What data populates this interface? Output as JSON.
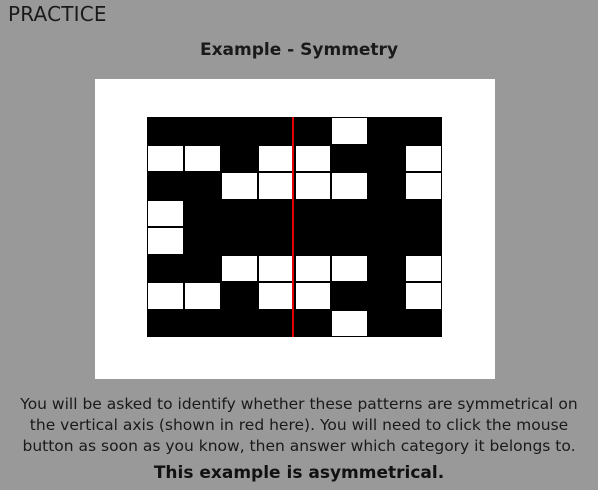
{
  "header": {
    "mode_label": "PRACTICE",
    "title": "Example - Symmetry"
  },
  "pattern": {
    "rows": 8,
    "cols": 8,
    "cells": [
      "00000100",
      "11011001",
      "00111101",
      "10000000",
      "10000000",
      "00111101",
      "11011001",
      "00000100"
    ],
    "filled_color": "#000000",
    "empty_color": "#ffffff",
    "axis_color": "#e00000"
  },
  "instructions": "You will be asked to identify whether these patterns are symmetrical on the vertical axis (shown in red here). You will need to click the mouse button as soon as you know, then answer which category it belongs to.",
  "result": "This example is asymmetrical."
}
